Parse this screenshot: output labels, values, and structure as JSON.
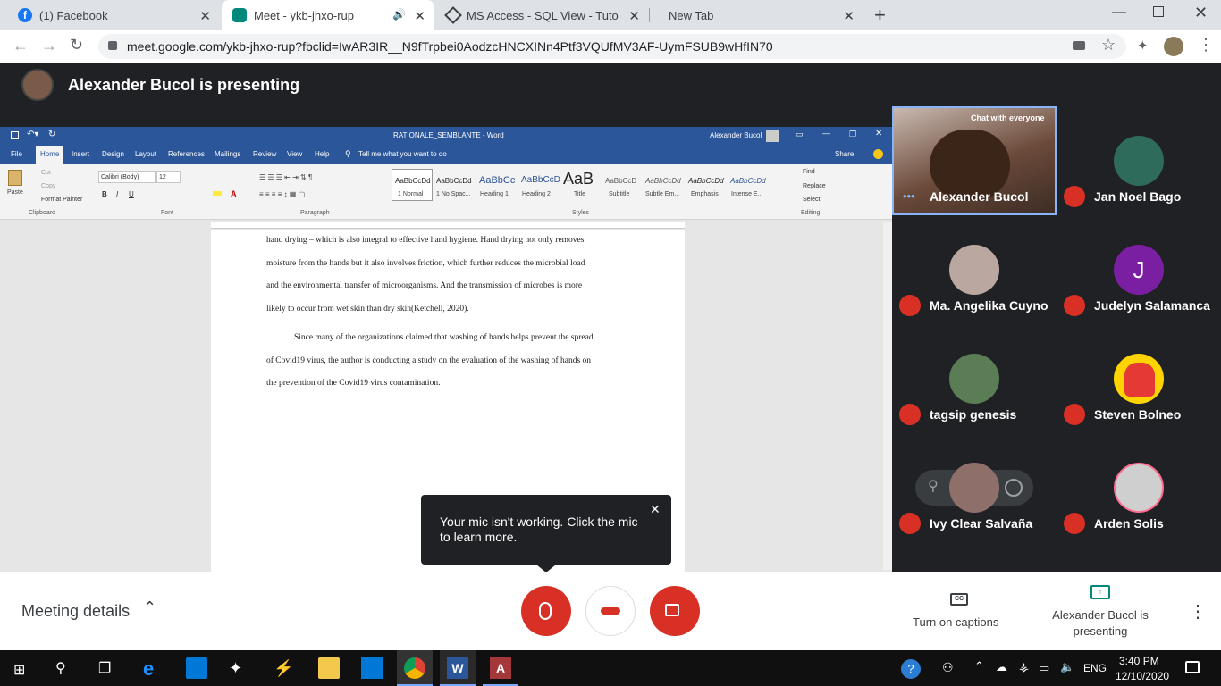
{
  "tabs": [
    {
      "title": "(1) Facebook",
      "icon": "facebook-icon"
    },
    {
      "title": "Meet - ykb-jhxo-rup",
      "icon": "meet-icon"
    },
    {
      "title": "MS Access - SQL View - Tutorials",
      "icon": "tutorials-icon"
    },
    {
      "title": "New Tab",
      "icon": ""
    }
  ],
  "address": {
    "url": "meet.google.com/ykb-jhxo-rup?fbclid=IwAR3IR__N9fTrpbei0AodzcHNCXINn4Ptf3VQUfMV3AF-UymFSUB9wHfIN70"
  },
  "presenter": {
    "banner": "Alexander Bucol is presenting"
  },
  "word": {
    "doc_title": "RATIONALE_SEMBLANTE  -  Word",
    "user": "Alexander Bucol",
    "menu": [
      "File",
      "Home",
      "Insert",
      "Design",
      "Layout",
      "References",
      "Mailings",
      "Review",
      "View",
      "Help"
    ],
    "tell_me": "Tell me what you want to do",
    "share": "Share",
    "clipboard": {
      "paste": "Paste",
      "cut": "Cut",
      "copy": "Copy",
      "format_painter": "Format Painter",
      "group": "Clipboard"
    },
    "font": {
      "name": "Calibri (Body)",
      "size": "12",
      "group": "Font"
    },
    "paragraph_group": "Paragraph",
    "styles": [
      {
        "preview": "AaBbCcDd",
        "label": "1 Normal"
      },
      {
        "preview": "AaBbCcDd",
        "label": "1 No Spac..."
      },
      {
        "preview": "AaBbCc",
        "label": "Heading 1"
      },
      {
        "preview": "AaBbCcD",
        "label": "Heading 2"
      },
      {
        "preview": "AaB",
        "label": "Title"
      },
      {
        "preview": "AaBbCcD",
        "label": "Subtitle"
      },
      {
        "preview": "AaBbCcDd",
        "label": "Subtle Em..."
      },
      {
        "preview": "AaBbCcDd",
        "label": "Emphasis"
      },
      {
        "preview": "AaBbCcDd",
        "label": "Intense E..."
      }
    ],
    "styles_group": "Styles",
    "editing": {
      "find": "Find",
      "replace": "Replace",
      "select": "Select",
      "group": "Editing"
    },
    "paragraphs": [
      [
        "hand drying – which is also integral to effective hand hygiene. Hand drying not only removes",
        "moisture from the hands but it also involves friction, which further reduces the microbial load",
        "and the environmental transfer of microorganisms. And the transmission of microbes is more",
        "likely to occur from wet skin than dry skin(Ketchell, 2020)."
      ],
      [
        "Since many of the organizations claimed that washing of hands helps prevent the spread",
        "of Covid19 virus, the author is conducting a study on the evaluation of the washing of hands on",
        "the prevention of the Covid19 virus contamination."
      ]
    ]
  },
  "participants": [
    {
      "name": "Alexander Bucol",
      "initial": "",
      "color": "#6b4a3a",
      "muted": false,
      "speaking": true,
      "label": "Chat with everyone"
    },
    {
      "name": "Jan Noel Bago",
      "initial": "",
      "color": "#2f6b5b",
      "muted": true
    },
    {
      "name": "Ma. Angelika Cuyno",
      "initial": "",
      "color": "#b9a7a0",
      "muted": true
    },
    {
      "name": "Judelyn Salamanca",
      "initial": "J",
      "color": "#7b1fa2",
      "muted": true
    },
    {
      "name": "tagsip genesis",
      "initial": "",
      "color": "#5a7d55",
      "muted": true
    },
    {
      "name": "Steven Bolneo",
      "initial": "",
      "color": "#ffd400",
      "muted": true
    },
    {
      "name": "Ivy Clear Salvaña",
      "initial": "",
      "color": "#8f6f6a",
      "muted": true
    },
    {
      "name": "Arden Solis",
      "initial": "",
      "color": "#cfcfcf",
      "muted": true
    }
  ],
  "toast": {
    "message": "Your mic isn't working. Click the mic to learn more."
  },
  "bottom": {
    "meeting_details": "Meeting details",
    "captions": "Turn on captions",
    "presenting": "Alexander Bucol is presenting"
  },
  "colors": {
    "meet_red": "#d93025",
    "word_blue": "#2b579a",
    "meet_bg": "#202124"
  },
  "taskbar": {
    "lang": "ENG",
    "time": "3:40 PM",
    "date": "12/10/2020"
  }
}
